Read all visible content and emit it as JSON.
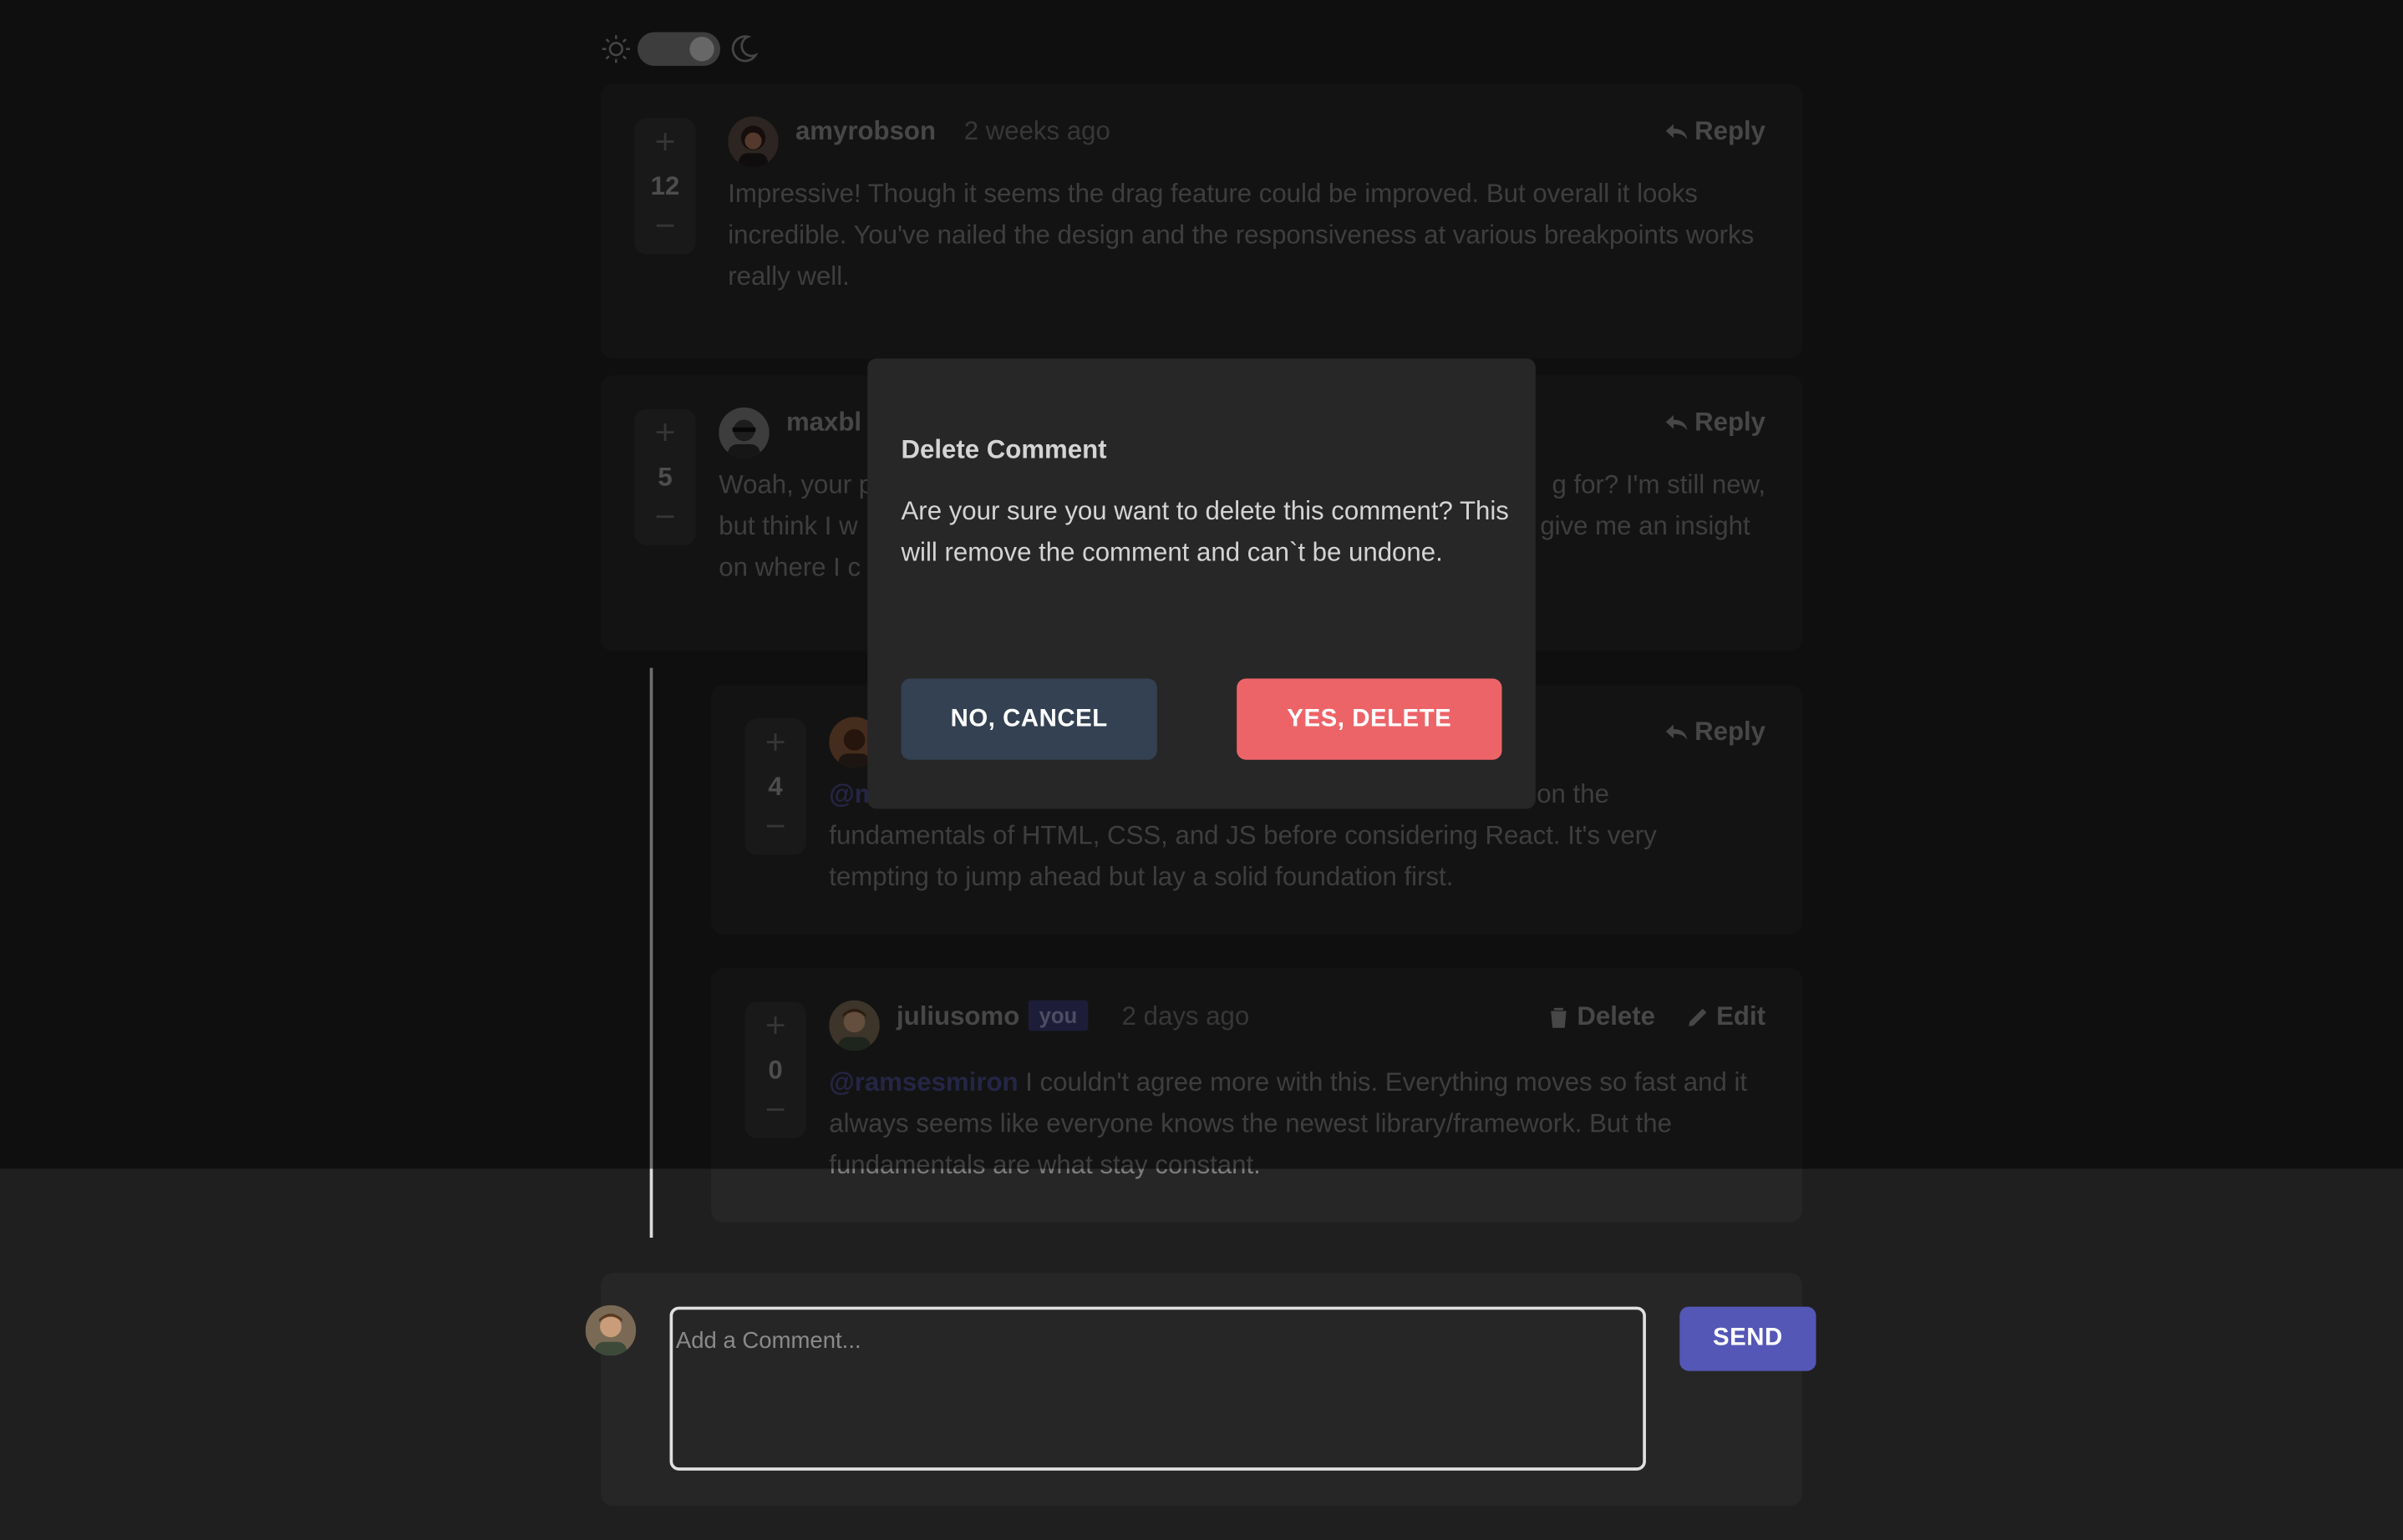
{
  "theme": {
    "sun_icon": "sun-icon",
    "moon_icon": "moon-icon",
    "mode": "dark"
  },
  "comments": [
    {
      "score": "12",
      "username": "amyrobson",
      "date": "2 weeks ago",
      "action": "Reply",
      "text": "Impressive! Though it seems the drag feature could be improved. But overall it looks incredible. You've nailed the design and the responsiveness at various breakpoints works really well."
    },
    {
      "score": "5",
      "username": "maxbl",
      "date": "",
      "action": "Reply",
      "text_left_line1": "Woah, your p",
      "text_right_line1": "g for? I'm still new,",
      "text_left_line2": "but think I w",
      "text_right_line2": "give me an insight",
      "text_left_line3": "on where I c"
    }
  ],
  "replies": [
    {
      "score": "4",
      "action": "Reply",
      "mention_partial": "@m",
      "text_right_line1": "on the",
      "text_line2": "fundamentals of HTML, CSS, and JS before considering React. It's very",
      "text_line3": "tempting to jump ahead but lay a solid foundation first."
    },
    {
      "score": "0",
      "username": "juliusomo",
      "badge": "you",
      "date": "2 days ago",
      "delete_label": "Delete",
      "edit_label": "Edit",
      "mention": "@ramsesmiron",
      "text": " I couldn't agree more with this. Everything moves so fast and it always seems like everyone knows the newest library/framework. But the fundamentals are what stay constant."
    }
  ],
  "modal": {
    "title": "Delete Comment",
    "message": "Are your sure you want to delete this comment? This will remove the comment and can`t be undone.",
    "cancel_label": "NO, CANCEL",
    "confirm_label": "YES, DELETE"
  },
  "composer": {
    "placeholder": "Add a Comment...",
    "send_label": "SEND"
  },
  "colors": {
    "background": "#1f1f1f",
    "card": "#262626",
    "cancel_button": "#334152",
    "delete_button": "#ed6468",
    "send_button": "#5457b6",
    "you_badge": "#3b3b74"
  }
}
